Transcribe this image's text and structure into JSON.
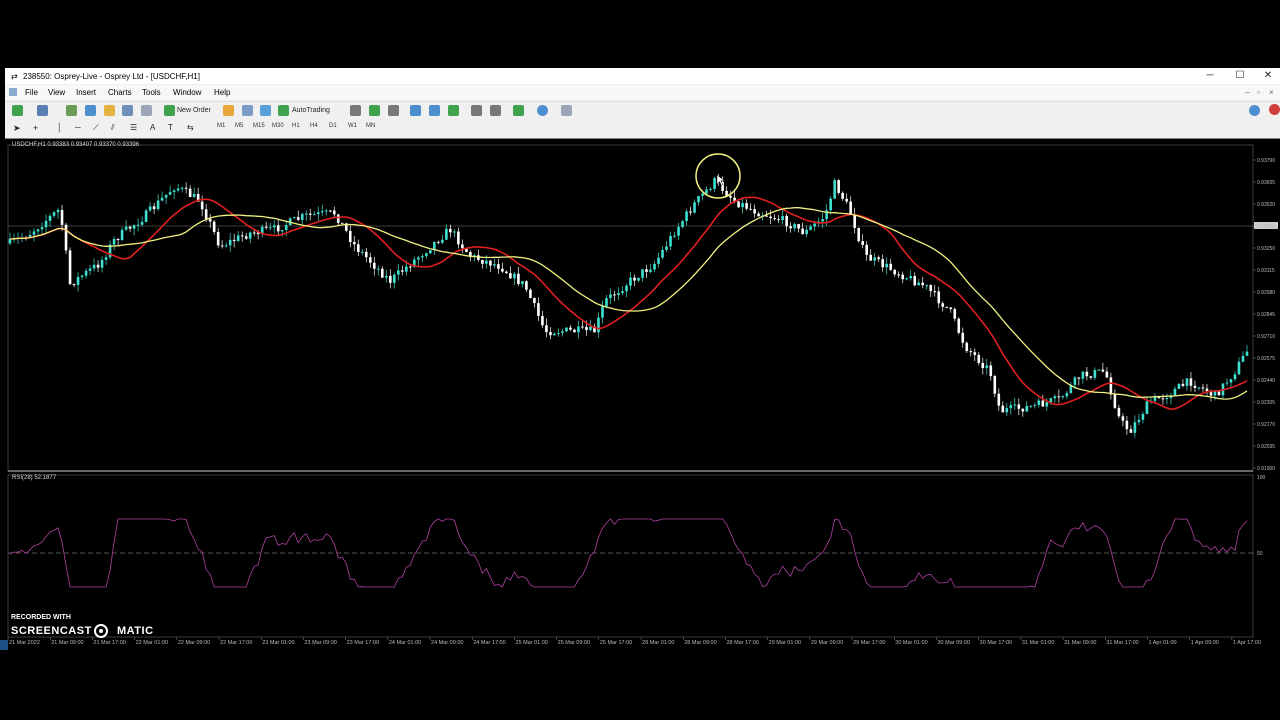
{
  "window": {
    "title": "238550: Osprey-Live - Osprey Ltd - [USDCHF,H1]",
    "controls": {
      "minimize": "─",
      "maximize": "☐",
      "close": "✕"
    }
  },
  "menu": {
    "items": [
      "File",
      "View",
      "Insert",
      "Charts",
      "Tools",
      "Window",
      "Help"
    ]
  },
  "toolbar": {
    "new_order": "New Order",
    "autotrading": "AutoTrading"
  },
  "timeframes": [
    "M1",
    "M5",
    "M15",
    "M30",
    "H1",
    "H4",
    "D1",
    "W1",
    "MN"
  ],
  "chart": {
    "header": "USDCHF,H1  0.93383 0.93407 0.93370 0.93396",
    "current_price": "0.93396",
    "price_ticks": [
      "0.93790",
      "0.93655",
      "0.93520",
      "0.93396",
      "0.93250",
      "0.93115",
      "0.92980",
      "0.92845",
      "0.92710",
      "0.92575",
      "0.92440",
      "0.92305",
      "0.92170",
      "0.92035",
      "0.91900"
    ],
    "date_ticks": [
      "21 Mar 2022",
      "21 Mar 09:00",
      "21 Mar 17:00",
      "22 Mar 01:00",
      "22 Mar 09:00",
      "22 Mar 17:00",
      "23 Mar 01:00",
      "23 Mar 09:00",
      "23 Mar 17:00",
      "24 Mar 01:00",
      "24 Mar 09:00",
      "24 Mar 17:00",
      "25 Mar 01:00",
      "25 Mar 09:00",
      "25 Mar 17:00",
      "28 Mar 01:00",
      "28 Mar 09:00",
      "28 Mar 17:00",
      "29 Mar 01:00",
      "29 Mar 09:00",
      "29 Mar 17:00",
      "30 Mar 01:00",
      "30 Mar 09:00",
      "30 Mar 17:00",
      "31 Mar 01:00",
      "31 Mar 09:00",
      "31 Mar 17:00",
      "1 Apr 01:00",
      "1 Apr 09:00",
      "1 Apr 17:00"
    ],
    "colors": {
      "bull": "#40e0d0",
      "bear": "#ffffff",
      "ma_fast": "#e02020",
      "ma_slow": "#f0f080",
      "rsi": "#b040a0",
      "highlight": "#f0f080"
    }
  },
  "rsi": {
    "label": "RSI(28) 52.1877",
    "scale_top": "100",
    "level": "50"
  },
  "watermark": {
    "line1": "RECORDED WITH",
    "line2_a": "SCREENCAST",
    "line2_b": "MATIC"
  }
}
